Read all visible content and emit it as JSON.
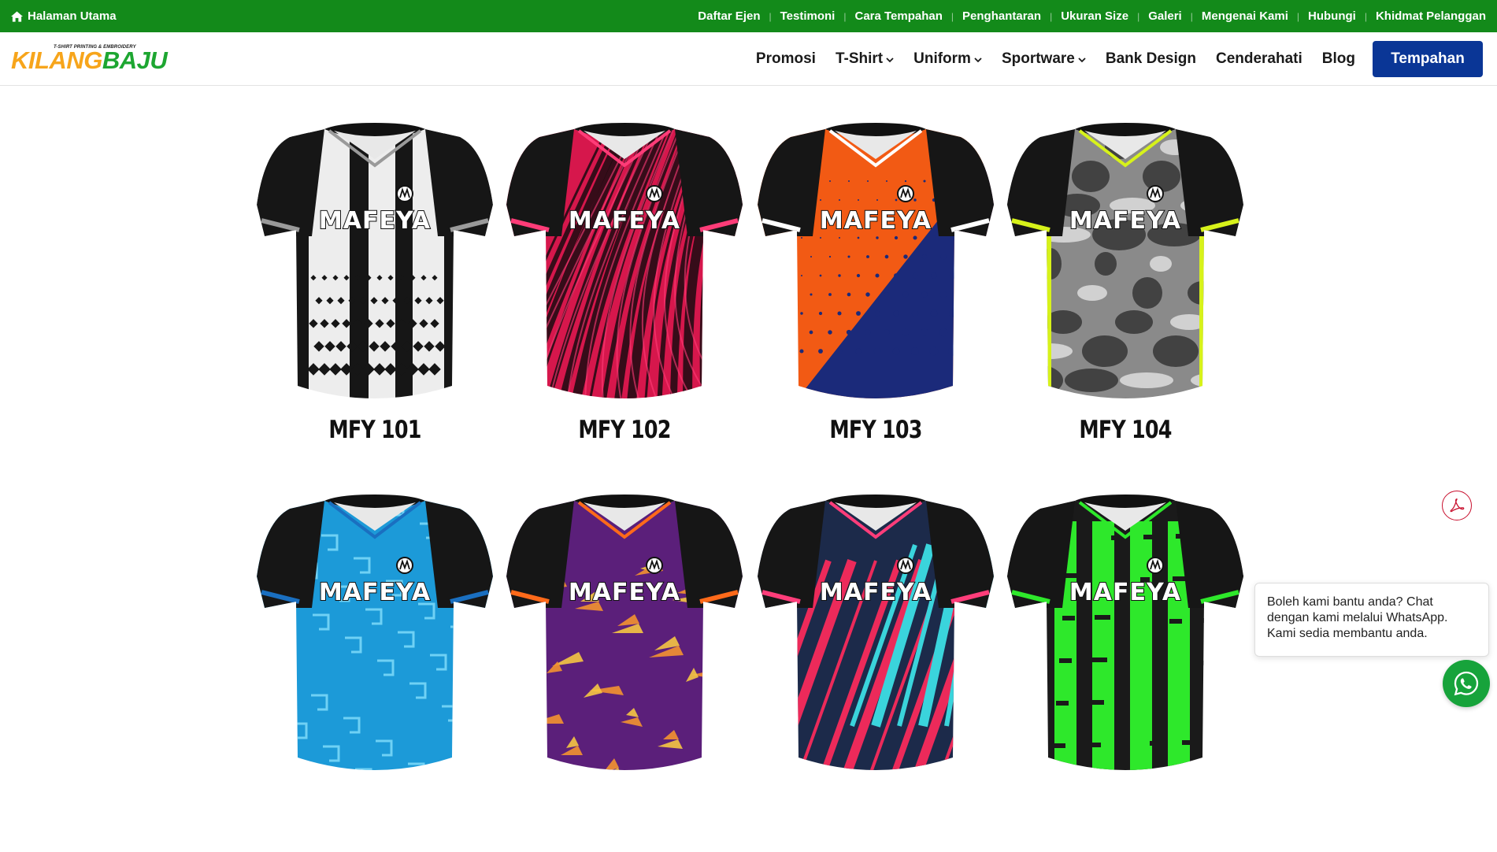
{
  "topbar": {
    "home_label": "Halaman Utama",
    "links": [
      "Daftar Ejen",
      "Testimoni",
      "Cara Tempahan",
      "Penghantaran",
      "Ukuran Size",
      "Galeri",
      "Mengenai Kami",
      "Hubungi",
      "Khidmat Pelanggan"
    ]
  },
  "logo": {
    "tagline": "T-SHIRT PRINTING & EMBROIDERY",
    "word_part1": "KILANG",
    "word_part2": "BAJU"
  },
  "nav": {
    "items": [
      "Promosi",
      "T-Shirt",
      "Uniform",
      "Sportware",
      "Bank Design",
      "Cenderahati",
      "Blog"
    ],
    "cta_label": "Tempahan"
  },
  "products": [
    {
      "code": "MFY 101",
      "brand": "MAFEYA",
      "pattern": "stripes-halftone",
      "primary": "#ededed",
      "secondary": "#161616",
      "trim": "#9a9a9a"
    },
    {
      "code": "MFY 102",
      "brand": "MAFEYA",
      "pattern": "brush",
      "primary": "#d6174c",
      "secondary": "#1a0a10",
      "trim": "#ff3c78"
    },
    {
      "code": "MFY 103",
      "brand": "MAFEYA",
      "pattern": "halftone-split",
      "primary": "#f25a14",
      "secondary": "#1b2a7a",
      "trim": "#ffffff"
    },
    {
      "code": "MFY 104",
      "brand": "MAFEYA",
      "pattern": "camo",
      "primary": "#8a8a8a",
      "secondary": "#3a3a3a",
      "trim": "#d7f21a"
    },
    {
      "code": "",
      "brand": "MAFEYA",
      "pattern": "maze",
      "primary": "#1c9ad8",
      "secondary": "#6fd1f5",
      "trim": "#1a6fc0"
    },
    {
      "code": "",
      "brand": "MAFEYA",
      "pattern": "splatter",
      "primary": "#5b1f7a",
      "secondary": "#f39230",
      "trim": "#ff6a1a"
    },
    {
      "code": "",
      "brand": "MAFEYA",
      "pattern": "slash",
      "primary": "#1c2a4a",
      "secondary": "#ec2a5a",
      "trim": "#ff3d7a"
    },
    {
      "code": "",
      "brand": "MAFEYA",
      "pattern": "grunge-stripes",
      "primary": "#1a1a1a",
      "secondary": "#2ee82b",
      "trim": "#2ee82b"
    }
  ],
  "whatsapp": {
    "message": "Boleh kami bantu anda? Chat dengan kami melalui WhatsApp. Kami sedia membantu anda."
  },
  "icons": {
    "home": "home-icon",
    "chevron": "chevron-down-icon",
    "pdf": "pdf-icon",
    "whatsapp": "whatsapp-icon"
  }
}
